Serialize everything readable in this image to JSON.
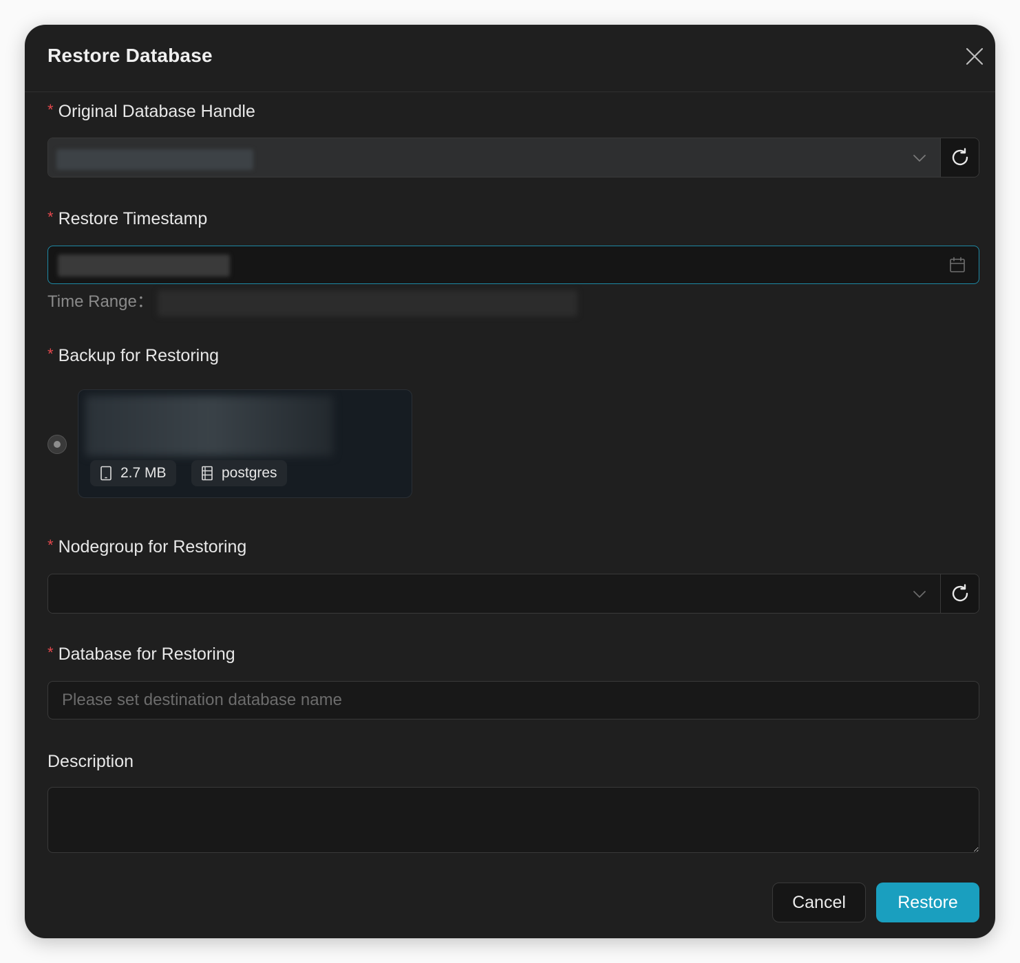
{
  "dialog": {
    "title": "Restore Database"
  },
  "form": {
    "required_marker": "*",
    "original_handle": {
      "label": "Original Database Handle"
    },
    "restore_timestamp": {
      "label": "Restore Timestamp",
      "hint": "Time Range："
    },
    "backup": {
      "label": "Backup for Restoring",
      "size": "2.7 MB",
      "db_type": "postgres"
    },
    "nodegroup": {
      "label": "Nodegroup for Restoring"
    },
    "database": {
      "label": "Database for Restoring",
      "placeholder": "Please set destination database name"
    },
    "description": {
      "label": "Description"
    }
  },
  "actions": {
    "cancel_label": "Cancel",
    "restore_label": "Restore"
  },
  "icons": {
    "close": "close-icon",
    "chevron": "chevron-down-icon",
    "refresh": "refresh-icon",
    "calendar": "calendar-icon",
    "size": "tablet-icon",
    "db": "database-icon"
  },
  "colors": {
    "accent": "#1a9fbf",
    "required": "#e5484d",
    "focus_border": "#1e8aa6",
    "dialog_bg": "#1f1f1f"
  }
}
